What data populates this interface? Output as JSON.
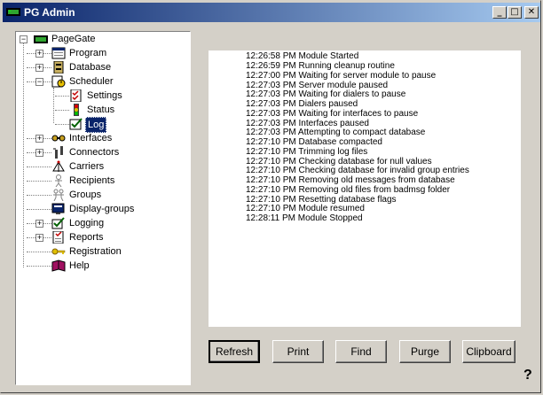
{
  "window": {
    "title": "PG Admin",
    "controls": {
      "minimize": "_",
      "maximize": "□",
      "close": "✕"
    }
  },
  "tree": {
    "root": {
      "label": "PageGate",
      "icon": "pager-icon"
    },
    "items": [
      {
        "label": "Program",
        "icon": "program-icon",
        "expander": "+"
      },
      {
        "label": "Database",
        "icon": "database-icon",
        "expander": "+"
      },
      {
        "label": "Scheduler",
        "icon": "scheduler-icon",
        "expander": "−"
      },
      {
        "label": "Settings",
        "icon": "settings-icon",
        "child": true
      },
      {
        "label": "Status",
        "icon": "status-icon",
        "child": true
      },
      {
        "label": "Log",
        "icon": "log-icon",
        "child": true,
        "selected": true
      },
      {
        "label": "Interfaces",
        "icon": "interfaces-icon",
        "expander": "+"
      },
      {
        "label": "Connectors",
        "icon": "connectors-icon",
        "expander": "+"
      },
      {
        "label": "Carriers",
        "icon": "carriers-icon"
      },
      {
        "label": "Recipients",
        "icon": "recipients-icon"
      },
      {
        "label": "Groups",
        "icon": "groups-icon"
      },
      {
        "label": "Display-groups",
        "icon": "display-groups-icon"
      },
      {
        "label": "Logging",
        "icon": "logging-icon",
        "expander": "+"
      },
      {
        "label": "Reports",
        "icon": "reports-icon",
        "expander": "+"
      },
      {
        "label": "Registration",
        "icon": "key-icon"
      },
      {
        "label": "Help",
        "icon": "book-icon"
      }
    ]
  },
  "log": [
    "12:26:58 PM  Module Started",
    "12:26:59 PM  Running cleanup routine",
    "12:27:00 PM  Waiting for server module to pause",
    "12:27:03 PM  Server module paused",
    "12:27:03 PM  Waiting for dialers to pause",
    "12:27:03 PM  Dialers paused",
    "12:27:03 PM  Waiting for interfaces to pause",
    "12:27:03 PM  Interfaces paused",
    "12:27:03 PM  Attempting to compact database",
    "12:27:10 PM  Database compacted",
    "12:27:10 PM  Trimming log files",
    "12:27:10 PM  Checking database for null values",
    "12:27:10 PM  Checking database for invalid group entries",
    "12:27:10 PM  Removing old messages from database",
    "12:27:10 PM  Removing old files from badmsg folder",
    "12:27:10 PM  Resetting database flags",
    "12:27:10 PM  Module resumed",
    "12:28:11 PM  Module Stopped"
  ],
  "buttons": {
    "refresh": "Refresh",
    "print": "Print",
    "find": "Find",
    "purge": "Purge",
    "clipboard": "Clipboard"
  },
  "help": "?"
}
